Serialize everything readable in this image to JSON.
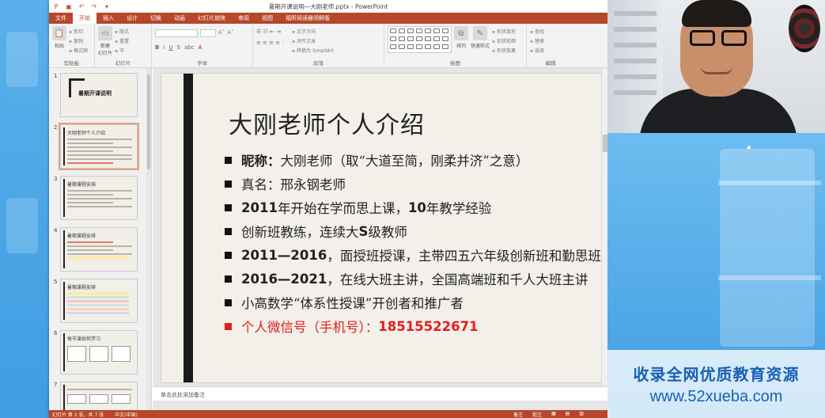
{
  "window": {
    "title": "暑期开课说明—大刚老师.pptx - PowerPoint"
  },
  "tabs": [
    "文件",
    "开始",
    "插入",
    "设计",
    "切换",
    "动画",
    "幻灯片放映",
    "审阅",
    "视图",
    "福昕阅读器领鲜版"
  ],
  "ribbon": {
    "groups": {
      "clipboard": {
        "label": "剪贴板",
        "paste": "粘贴",
        "cut": "剪切",
        "copy": "复制",
        "format_painter": "格式刷"
      },
      "slides": {
        "label": "幻灯片",
        "new_slide": "新建\n幻灯片",
        "layout": "版式",
        "reset": "重置",
        "section": "节"
      },
      "font": {
        "label": "字体"
      },
      "paragraph": {
        "label": "段落",
        "text_direction": "文字方向",
        "align_text": "对齐文本",
        "smartart": "转换为 SmartArt"
      },
      "drawing": {
        "label": "绘图",
        "arrange": "排列",
        "quick_styles": "快速样式",
        "fill": "形状填充",
        "outline": "形状轮廓",
        "effects": "形状效果"
      },
      "editing": {
        "label": "编辑",
        "find": "查找",
        "replace": "替换",
        "select": "选择"
      }
    }
  },
  "thumbnails": [
    {
      "num": "1",
      "title": "暑期开课说明"
    },
    {
      "num": "2",
      "title": "大刚老师个人介绍"
    },
    {
      "num": "3",
      "title": "暑期课程安排"
    },
    {
      "num": "4",
      "title": "暑期课程安排"
    },
    {
      "num": "5",
      "title": "暑期课程安排"
    },
    {
      "num": "6",
      "title": "每节课如何学习"
    },
    {
      "num": "7",
      "title": ""
    }
  ],
  "slide": {
    "title": "大刚老师个人介绍",
    "bullets": [
      {
        "bold": "昵称：",
        "text": "大刚老师（取“大道至简，刚柔并济”之意）",
        "red": false
      },
      {
        "bold": "",
        "text": "真名：邢永钢老师",
        "red": false
      },
      {
        "bold": "2011",
        "text": "年开始在学而思上课，",
        "bold2": "10",
        "text2": "年教学经验",
        "red": false
      },
      {
        "bold": "",
        "text": "创新班教练，连续大",
        "bold2": "S",
        "text2": "级教师",
        "red": false
      },
      {
        "bold": "2011—2016",
        "text": "，面授班授课，主带四五六年级创新班和勤思班",
        "red": false
      },
      {
        "bold": "2016—2021",
        "text": "，在线大班主讲，全国高端班和千人大班主讲",
        "red": false
      },
      {
        "bold": "",
        "text": "小高数学“体系性授课”开创者和推广者",
        "red": false
      },
      {
        "bold": "",
        "text": "个人微信号（手机号）：",
        "bold2": "18515522671",
        "text2": "",
        "red": true
      }
    ]
  },
  "notes_placeholder": "单击此处添加备注",
  "statusbar": {
    "slide_info": "幻灯片 第 2 张，共 7 张",
    "language": "中文(中国)",
    "notes": "备注",
    "comments": "批注"
  },
  "watermark": {
    "line1": "收录全网优质教育资源",
    "line2": "www.52xueba.com"
  },
  "colors": {
    "accent": "#b7472a",
    "bullet_red": "#e02020",
    "watermark_blue": "#1a60b5"
  }
}
